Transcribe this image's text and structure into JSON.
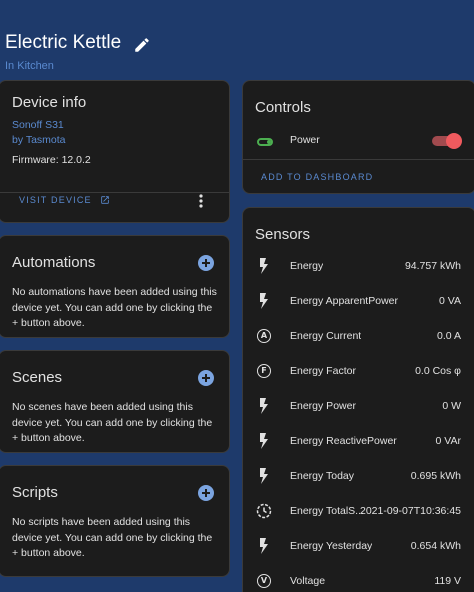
{
  "header": {
    "title": "Electric Kettle",
    "area": "In Kitchen"
  },
  "device_info": {
    "title": "Device info",
    "model": "Sonoff S31",
    "manufacturer": "by Tasmota",
    "firmware": "Firmware: 12.0.2",
    "visit_label": "VISIT DEVICE"
  },
  "automations": {
    "title": "Automations",
    "empty_text": "No automations have been added using this device yet. You can add one by clicking the + button above."
  },
  "scenes": {
    "title": "Scenes",
    "empty_text": "No scenes have been added using this device yet. You can add one by clicking the + button above."
  },
  "scripts": {
    "title": "Scripts",
    "empty_text": "No scripts have been added using this device yet. You can add one by clicking the + button above."
  },
  "controls": {
    "title": "Controls",
    "items": [
      {
        "label": "Power",
        "state": "on",
        "icon": "power-socket-toggle-icon"
      }
    ],
    "add_label": "ADD TO DASHBOARD",
    "switch_color": "#f05a5e"
  },
  "sensors": {
    "title": "Sensors",
    "items": [
      {
        "name": "Energy",
        "value": "94.757 kWh",
        "icon": "flash-icon"
      },
      {
        "name": "Energy ApparentPower",
        "value": "0 VA",
        "icon": "flash-icon"
      },
      {
        "name": "Energy Current",
        "value": "0.0 A",
        "icon": "current-ac-icon"
      },
      {
        "name": "Energy Factor",
        "value": "0.0 Cos φ",
        "icon": "power-factor-icon"
      },
      {
        "name": "Energy Power",
        "value": "0 W",
        "icon": "flash-icon"
      },
      {
        "name": "Energy ReactivePower",
        "value": "0 VAr",
        "icon": "flash-icon"
      },
      {
        "name": "Energy Today",
        "value": "0.695 kWh",
        "icon": "flash-icon"
      },
      {
        "name": "Energy TotalS...",
        "value": "2021-09-07T10:36:45",
        "icon": "clock-icon"
      },
      {
        "name": "Energy Yesterday",
        "value": "0.654 kWh",
        "icon": "flash-icon"
      },
      {
        "name": "Voltage",
        "value": "119 V",
        "icon": "voltage-icon"
      }
    ]
  },
  "colors": {
    "background": "#1e3a6b",
    "card": "#1c1c1c",
    "accent": "#5a8ad0",
    "text": "#e1e1e1",
    "toggle_icon": "#4caf50"
  }
}
